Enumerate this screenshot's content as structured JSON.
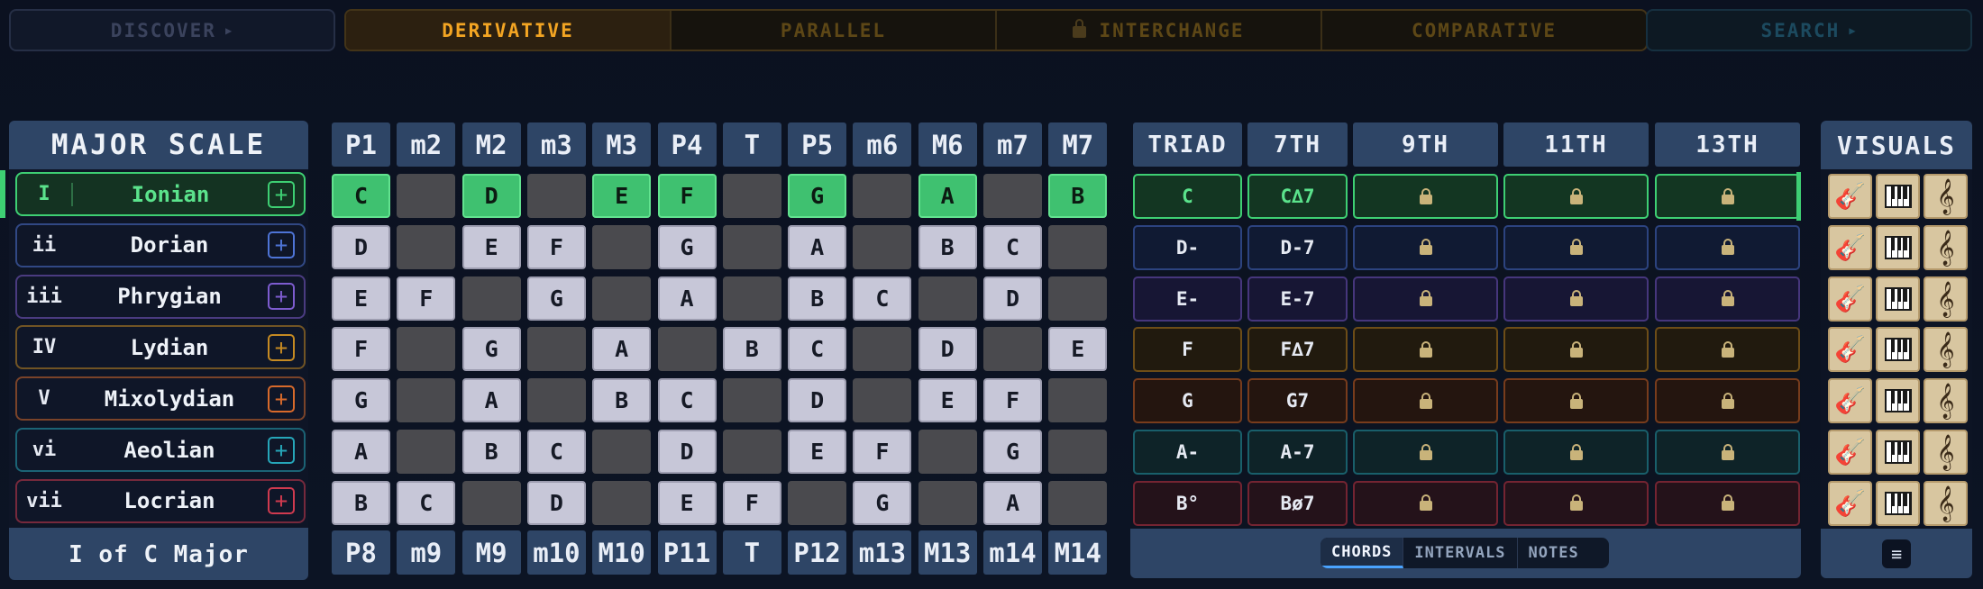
{
  "nav": {
    "discover": "DISCOVER",
    "search": "SEARCH",
    "modes": [
      "DERIVATIVE",
      "PARALLEL",
      "INTERCHANGE",
      "COMPARATIVE"
    ],
    "active_mode": "DERIVATIVE",
    "locked_mode": "INTERCHANGE"
  },
  "scale": {
    "title": "MAJOR SCALE",
    "footer": "I of C Major",
    "modes": [
      {
        "numeral": "I",
        "name": "Ionian",
        "color": "#3ecf73",
        "selected": true
      },
      {
        "numeral": "ii",
        "name": "Dorian",
        "color": "#4e74d6"
      },
      {
        "numeral": "iii",
        "name": "Phrygian",
        "color": "#7d5ccf"
      },
      {
        "numeral": "IV",
        "name": "Lydian",
        "color": "#c68a22"
      },
      {
        "numeral": "V",
        "name": "Mixolydian",
        "color": "#d86a2b"
      },
      {
        "numeral": "vi",
        "name": "Aeolian",
        "color": "#26a6b9"
      },
      {
        "numeral": "vii",
        "name": "Locrian",
        "color": "#d03a4f"
      }
    ]
  },
  "intervals": {
    "top": [
      "P1",
      "m2",
      "M2",
      "m3",
      "M3",
      "P4",
      "T",
      "P5",
      "m6",
      "M6",
      "m7",
      "M7"
    ],
    "bottom": [
      "P8",
      "m9",
      "M9",
      "m10",
      "M10",
      "P11",
      "T",
      "P12",
      "m13",
      "M13",
      "m14",
      "M14"
    ],
    "rows": [
      [
        "C",
        "",
        "D",
        "",
        "E",
        "F",
        "",
        "G",
        "",
        "A",
        "",
        "B"
      ],
      [
        "D",
        "",
        "E",
        "F",
        "",
        "G",
        "",
        "A",
        "",
        "B",
        "C",
        ""
      ],
      [
        "E",
        "F",
        "",
        "G",
        "",
        "A",
        "",
        "B",
        "C",
        "",
        "D",
        ""
      ],
      [
        "F",
        "",
        "G",
        "",
        "A",
        "",
        "B",
        "C",
        "",
        "D",
        "",
        "E"
      ],
      [
        "G",
        "",
        "A",
        "",
        "B",
        "C",
        "",
        "D",
        "",
        "E",
        "F",
        ""
      ],
      [
        "A",
        "",
        "B",
        "C",
        "",
        "D",
        "",
        "E",
        "F",
        "",
        "G",
        ""
      ],
      [
        "B",
        "C",
        "",
        "D",
        "",
        "E",
        "F",
        "",
        "G",
        "",
        "A",
        ""
      ]
    ]
  },
  "chords": {
    "headers": [
      "TRIAD",
      "7TH",
      "9TH",
      "11TH",
      "13TH"
    ],
    "rows": [
      [
        "C",
        "C∆7"
      ],
      [
        "D-",
        "D-7"
      ],
      [
        "E-",
        "E-7"
      ],
      [
        "F",
        "F∆7"
      ],
      [
        "G",
        "G7"
      ],
      [
        "A-",
        "A-7"
      ],
      [
        "B°",
        "Bø7"
      ]
    ],
    "row_tints": [
      "#133622",
      "#101a33",
      "#171634",
      "#211a0e",
      "#24150f",
      "#0e2328",
      "#24121a"
    ],
    "tabs": [
      "CHORDS",
      "INTERVALS",
      "NOTES"
    ],
    "active_tab": "CHORDS"
  },
  "visuals": {
    "title": "VISUALS",
    "buttons": [
      "guitar-icon",
      "piano-icon",
      "treble-clef-icon"
    ]
  }
}
